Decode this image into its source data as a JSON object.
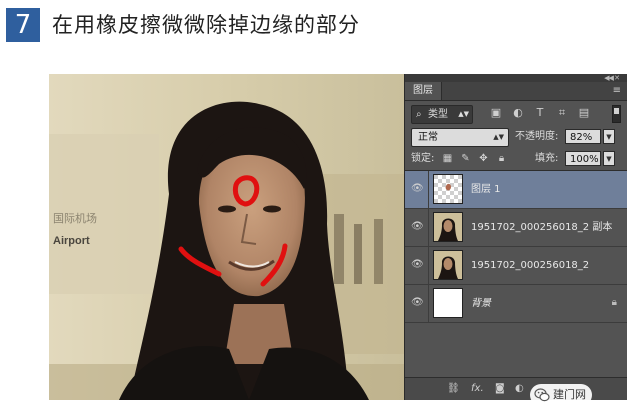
{
  "step": {
    "number": "7",
    "title": "在用橡皮擦微微除掉边缘的部分"
  },
  "canvas": {
    "sign_line1": "国际机场",
    "sign_line2": "Airport"
  },
  "layers_panel": {
    "tab_label": "图层",
    "filter": {
      "kind_label": "类型",
      "kind_icon": "search-icon",
      "filter_icons": [
        "image-filter-icon",
        "adjustment-filter-icon",
        "type-filter-icon",
        "shape-filter-icon",
        "smart-object-filter-icon"
      ]
    },
    "blend_mode": "正常",
    "opacity_label": "不透明度:",
    "opacity_value": "82%",
    "lock_label": "锁定:",
    "lock_icons": [
      "lock-transparent-pixels-icon",
      "lock-image-pixels-icon",
      "lock-position-icon",
      "lock-all-icon"
    ],
    "fill_label": "填充:",
    "fill_value": "100%",
    "layers": [
      {
        "name": "图层 1",
        "active": true,
        "visible": true
      },
      {
        "name": "1951702_000256018_2 副本",
        "active": false,
        "visible": true
      },
      {
        "name": "1951702_000256018_2",
        "active": false,
        "visible": true
      },
      {
        "name": "背景",
        "active": false,
        "visible": true,
        "locked": true
      }
    ],
    "bottom_icons": [
      "link-layers-icon",
      "fx-icon",
      "layer-mask-icon",
      "adjustment-layer-icon",
      "group-folder-icon",
      "new-layer-icon",
      "trash-icon"
    ]
  },
  "watermark": {
    "text": "建门网"
  },
  "colors": {
    "accent": "#2f5f9e",
    "panel_bg": "#535353",
    "selected_layer": "#6f7f9a",
    "annotation_red": "#e01010"
  }
}
